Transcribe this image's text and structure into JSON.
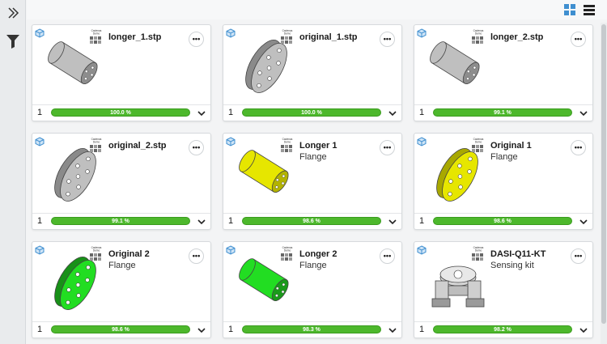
{
  "rail": {
    "expand_icon": "double-chevron-right-icon",
    "filter_icon": "filter-icon"
  },
  "toolbar": {
    "grid_view_icon": "grid-view-icon",
    "list_view_icon": "list-view-icon"
  },
  "logo_text": [
    "Cadenas",
    "Demo"
  ],
  "colors": {
    "progress": "#4db82c",
    "yellow": "#e6e600",
    "green": "#22dd22",
    "grey": "#bfbfbf",
    "accent": "#3f8fd0"
  },
  "cards": [
    {
      "title": "longer_1.stp",
      "subtitle": "",
      "qty": "1",
      "progress": "100.0 %",
      "thumb": "grey-long"
    },
    {
      "title": "original_1.stp",
      "subtitle": "",
      "qty": "1",
      "progress": "100.0 %",
      "thumb": "grey-disc"
    },
    {
      "title": "longer_2.stp",
      "subtitle": "",
      "qty": "1",
      "progress": "99.1 %",
      "thumb": "grey-long"
    },
    {
      "title": "original_2.stp",
      "subtitle": "",
      "qty": "1",
      "progress": "99.1 %",
      "thumb": "grey-disc"
    },
    {
      "title": "Longer 1",
      "subtitle": "Flange",
      "qty": "1",
      "progress": "98.6 %",
      "thumb": "yellow-long"
    },
    {
      "title": "Original 1",
      "subtitle": "Flange",
      "qty": "1",
      "progress": "98.6 %",
      "thumb": "yellow-disc"
    },
    {
      "title": "Original 2",
      "subtitle": "Flange",
      "qty": "1",
      "progress": "98.6 %",
      "thumb": "green-disc"
    },
    {
      "title": "Longer 2",
      "subtitle": "Flange",
      "qty": "1",
      "progress": "98.3 %",
      "thumb": "green-long"
    },
    {
      "title": "DASI-Q11-KT",
      "subtitle": "Sensing kit",
      "qty": "1",
      "progress": "98.2 %",
      "thumb": "assembly"
    }
  ]
}
